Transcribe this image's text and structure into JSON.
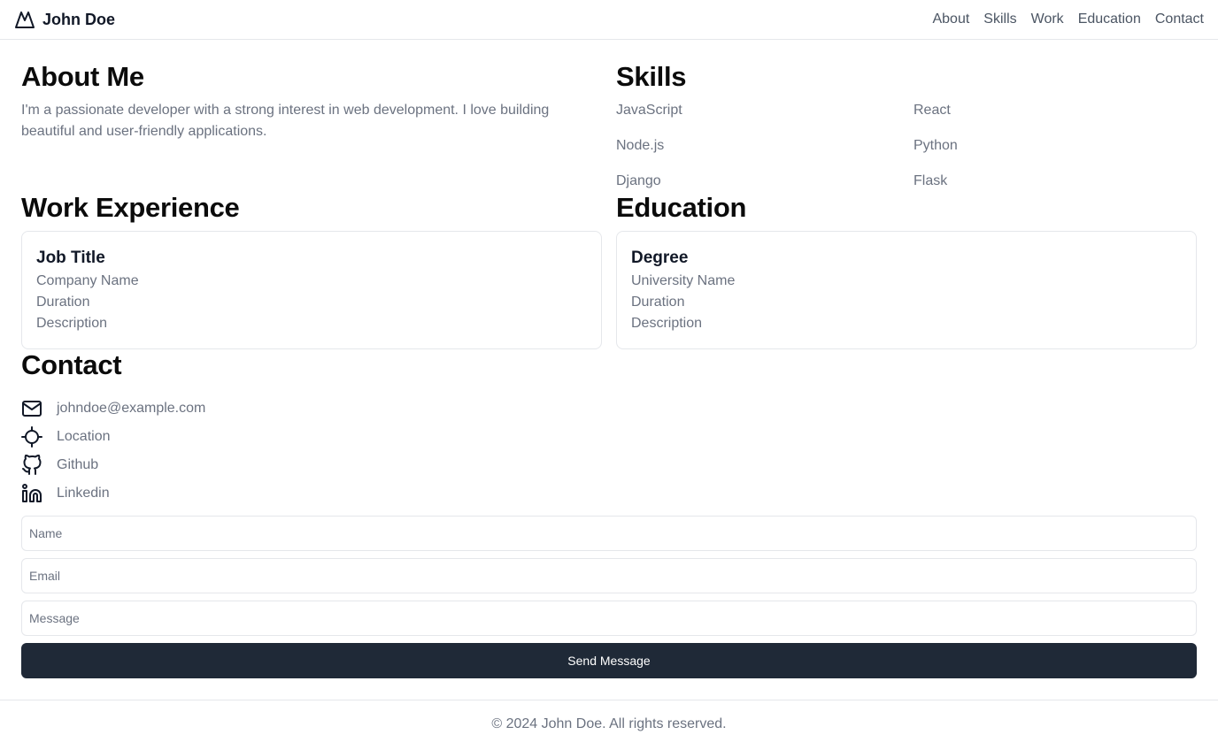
{
  "header": {
    "brand_name": "John Doe",
    "brand_icon": "mountain-icon",
    "nav": [
      {
        "label": "About"
      },
      {
        "label": "Skills"
      },
      {
        "label": "Work"
      },
      {
        "label": "Education"
      },
      {
        "label": "Contact"
      }
    ]
  },
  "about": {
    "title": "About Me",
    "text": "I'm a passionate developer with a strong interest in web development. I love building beautiful and user-friendly applications."
  },
  "skills": {
    "title": "Skills",
    "items": [
      "JavaScript",
      "React",
      "Node.js",
      "Python",
      "Django",
      "Flask"
    ]
  },
  "work": {
    "title": "Work Experience",
    "card": {
      "title": "Job Title",
      "company": "Company Name",
      "duration": "Duration",
      "description": "Description"
    }
  },
  "education": {
    "title": "Education",
    "card": {
      "title": "Degree",
      "school": "University Name",
      "duration": "Duration",
      "description": "Description"
    }
  },
  "contact": {
    "title": "Contact",
    "items": [
      {
        "icon": "mail-icon",
        "text": "johndoe@example.com"
      },
      {
        "icon": "location-crosshair-icon",
        "text": "Location"
      },
      {
        "icon": "github-icon",
        "text": "Github"
      },
      {
        "icon": "linkedin-icon",
        "text": "Linkedin"
      }
    ],
    "form": {
      "name_placeholder": "Name",
      "email_placeholder": "Email",
      "message_placeholder": "Message",
      "submit_label": "Send Message"
    }
  },
  "footer": {
    "text": "© 2024 John Doe. All rights reserved."
  },
  "colors": {
    "text": "#111827",
    "muted": "#6b7280",
    "border": "#e5e7eb",
    "button_bg": "#1f2937",
    "button_text": "#ffffff"
  }
}
